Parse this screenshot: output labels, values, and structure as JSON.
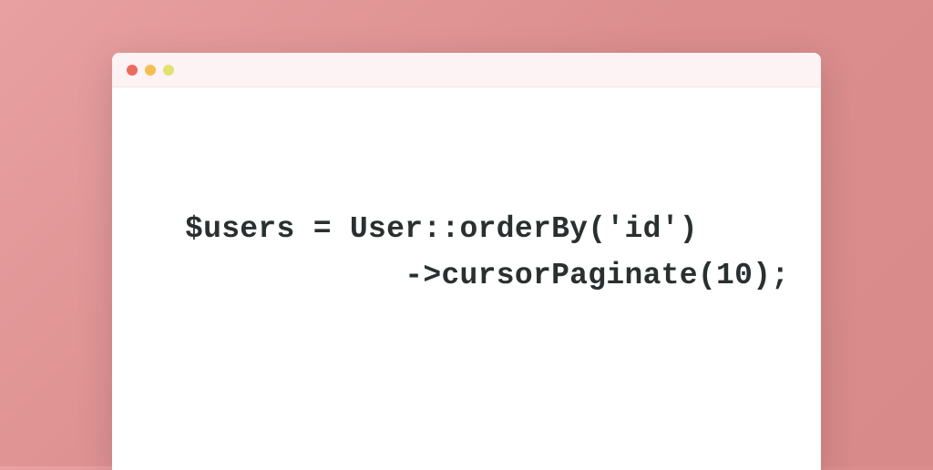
{
  "window": {
    "traffic_lights": {
      "red": "#ed6a5e",
      "yellow": "#f5bf4f",
      "green": "#e2e270"
    }
  },
  "code": {
    "line1": "$users = User::orderBy('id')",
    "line2": "            ->cursorPaginate(10);"
  }
}
